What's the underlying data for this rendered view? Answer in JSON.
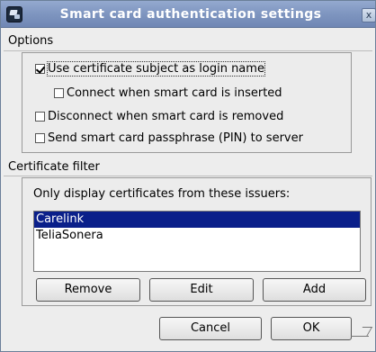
{
  "window": {
    "title": "Smart card authentication settings",
    "close_glyph": "x"
  },
  "options": {
    "label": "Options",
    "items": [
      {
        "label": "Use certificate subject as login name",
        "checked": true
      },
      {
        "label": "Connect when smart card is inserted",
        "checked": false
      },
      {
        "label": "Disconnect when smart card is removed",
        "checked": false
      },
      {
        "label": "Send smart card passphrase (PIN) to server",
        "checked": false
      }
    ]
  },
  "certificate_filter": {
    "label": "Certificate filter",
    "instruction": "Only display certificates from these issuers:",
    "issuers": [
      {
        "name": "Carelink",
        "selected": true
      },
      {
        "name": "TeliaSonera",
        "selected": false
      }
    ],
    "remove_label": "Remove",
    "edit_label": "Edit",
    "add_label": "Add"
  },
  "footer": {
    "cancel_label": "Cancel",
    "ok_label": "OK"
  },
  "colors": {
    "titlebar": "#8097c1",
    "selection": "#0a1f8a"
  }
}
